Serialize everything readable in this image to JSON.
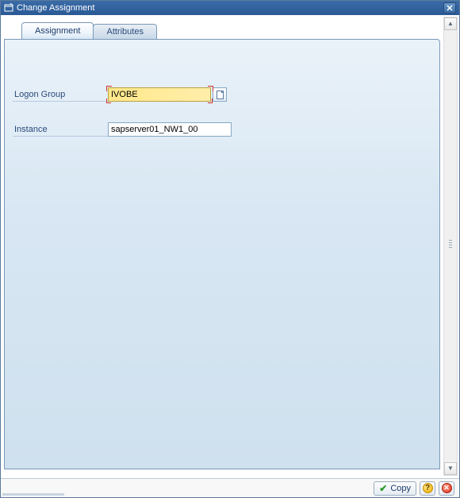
{
  "window": {
    "title": "Change Assignment"
  },
  "tabs": {
    "items": [
      {
        "label": "Assignment"
      },
      {
        "label": "Attributes"
      }
    ]
  },
  "form": {
    "logon_group": {
      "label": "Logon Group",
      "value": "IVOBE"
    },
    "instance": {
      "label": "Instance",
      "value": "sapserver01_NW1_00"
    }
  },
  "footer": {
    "copy_label": "Copy"
  }
}
